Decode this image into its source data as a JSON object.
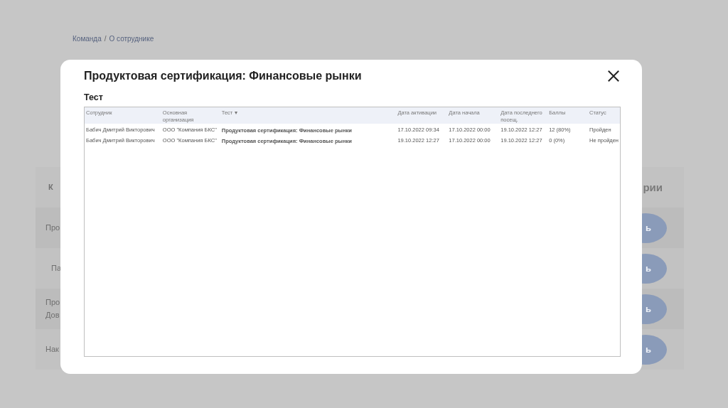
{
  "breadcrumb": [
    "Команда",
    "О сотруднике"
  ],
  "breadcrumb_separator": "/",
  "background_table": {
    "header": [
      "К",
      "рии"
    ],
    "rows": [
      {
        "lines": [
          "Про"
        ],
        "button": "ь"
      },
      {
        "lines": [
          "Па"
        ],
        "button": "ь"
      },
      {
        "lines": [
          "Про",
          "Дов"
        ],
        "button": "ь"
      },
      {
        "lines": [
          "Нак"
        ],
        "button": "ь"
      }
    ]
  },
  "modal": {
    "title": "Продуктовая сертификация: Финансовые рынки",
    "section": "Тест",
    "table": {
      "sort_marker": "▾",
      "columns": [
        {
          "label": "Сотрудник",
          "sorted": false
        },
        {
          "label": "Основная организация",
          "sorted": false
        },
        {
          "label": "Тест",
          "sorted": true
        },
        {
          "label": "Дата активации",
          "sorted": false
        },
        {
          "label": "Дата начала",
          "sorted": false
        },
        {
          "label": "Дата последнего посещ.",
          "sorted": false
        },
        {
          "label": "Баллы",
          "sorted": false
        },
        {
          "label": "Статус",
          "sorted": false
        }
      ],
      "rows": [
        [
          "Бабич Дмитрий Викторович",
          "ООО \"Компания БКС\"",
          "Продуктовая сертификация: Финансовые рынки",
          "17.10.2022 09:34",
          "17.10.2022 00:00",
          "19.10.2022 12:27",
          "12 (80%)",
          "Пройден"
        ],
        [
          "Бабич Дмитрий Викторович",
          "ООО \"Компания БКС\"",
          "Продуктовая сертификация: Финансовые рынки",
          "19.10.2022 12:27",
          "17.10.2022 00:00",
          "19.10.2022 12:27",
          "0 (0%)",
          "Не пройден"
        ]
      ]
    }
  }
}
